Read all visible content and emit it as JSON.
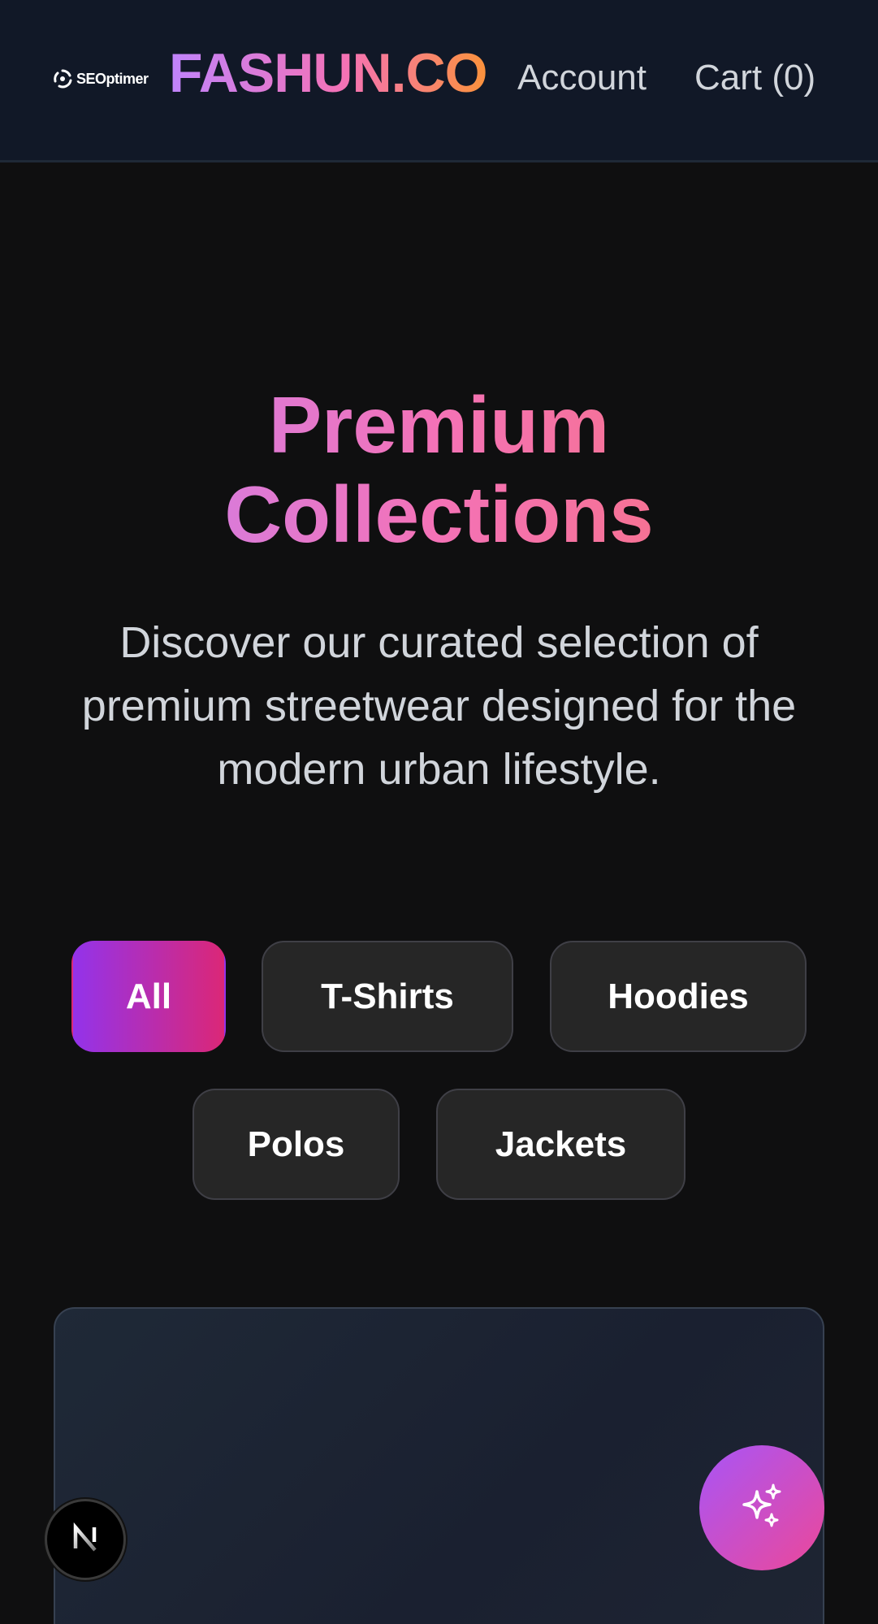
{
  "header": {
    "seo_logo_text": "SEOptimer",
    "brand": "FASHUN.CO",
    "nav": {
      "account": "Account",
      "cart": "Cart (0)"
    }
  },
  "hero": {
    "title_line1": "Premium",
    "title_line2": "Collections",
    "subtitle": "Discover our curated selection of premium streetwear designed for the modern urban lifestyle."
  },
  "filters": {
    "items": [
      {
        "label": "All",
        "active": true
      },
      {
        "label": "T-Shirts",
        "active": false
      },
      {
        "label": "Hoodies",
        "active": false
      },
      {
        "label": "Polos",
        "active": false
      },
      {
        "label": "Jackets",
        "active": false
      }
    ]
  },
  "floating": {
    "next_badge_icon": "nextjs-logo-icon",
    "ai_button_icon": "sparkles-icon"
  },
  "colors": {
    "header_bg": "#111827",
    "page_bg": "#0f0f10",
    "brand_gradient_start": "#c084fc",
    "brand_gradient_end": "#fb923c",
    "chip_active_start": "#9333ea",
    "chip_active_end": "#db2777"
  }
}
